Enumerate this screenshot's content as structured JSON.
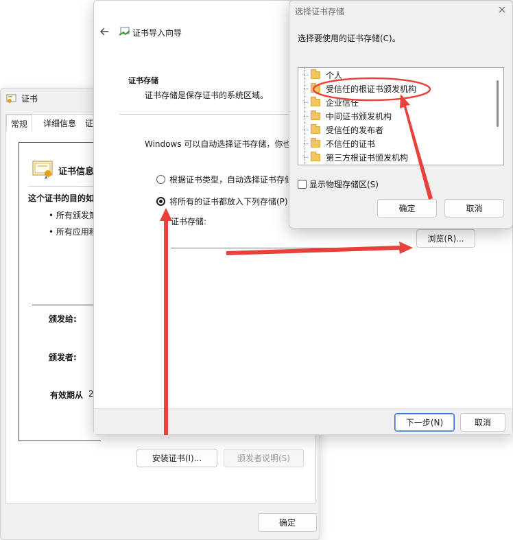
{
  "cert_dialog": {
    "title": "证书",
    "tabs": [
      "常规",
      "详细信息",
      "证"
    ],
    "cert_info_title": "证书信息",
    "purpose_heading": "这个证书的目的如",
    "bullets": [
      "• 所有颁发策",
      "• 所有应用程"
    ],
    "issued_to_label": "颁发给:",
    "issued_by_label": "颁发者:",
    "valid_from_label": "有效期从",
    "valid_from_value": "2",
    "install_button": "安装证书(I)...",
    "issuer_statement_button": "颁发者说明(S)",
    "ok_button": "确定"
  },
  "wizard": {
    "title": "证书导入向导",
    "section_heading": "证书存储",
    "section_desc": "证书存储是保存证书的系统区域。",
    "auto_text": "Windows 可以自动选择证书存储，你也",
    "radio_auto": "根据证书类型，自动选择证书存储",
    "radio_manual": "将所有的证书都放入下列存储(P)",
    "store_label": "证书存储:",
    "store_value": "",
    "browse_button": "浏览(R)...",
    "next_button": "下一步(N)",
    "cancel_button": "取消"
  },
  "store_dialog": {
    "title": "选择证书存储",
    "prompt": "选择要使用的证书存储(C)。",
    "items": [
      "个人",
      "受信任的根证书颁发机构",
      "企业信任",
      "中间证书颁发机构",
      "受信任的发布者",
      "不信任的证书",
      "第三方根证书颁发机构"
    ],
    "show_physical": "显示物理存储区(S)",
    "ok_button": "确定",
    "cancel_button": "取消"
  },
  "annotation_color": "#e8413c"
}
